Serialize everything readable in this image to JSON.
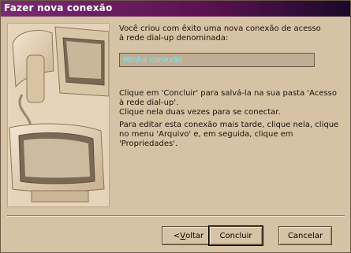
{
  "window": {
    "title": "Fazer nova conexão"
  },
  "content": {
    "intro": "Você criou com êxito uma nova conexão de acesso à rede dial-up denominada:",
    "connection_name": "Minha conexão",
    "instruction_save": "Clique em 'Concluir' para salvá-la na sua pasta 'Acesso à rede dial-up'.",
    "instruction_connect": "Clique nela duas vezes para se conectar.",
    "instruction_edit": "Para editar esta conexão mais tarde, clique nela, clique no menu 'Arquivo' e, em seguida, clique em 'Propriedades'."
  },
  "buttons": {
    "back_prefix": "< ",
    "back_accel": "V",
    "back_rest": "oltar",
    "finish": "Concluir",
    "cancel": "Cancelar"
  },
  "icons": {
    "illustration": "computer-phone-illustration"
  }
}
